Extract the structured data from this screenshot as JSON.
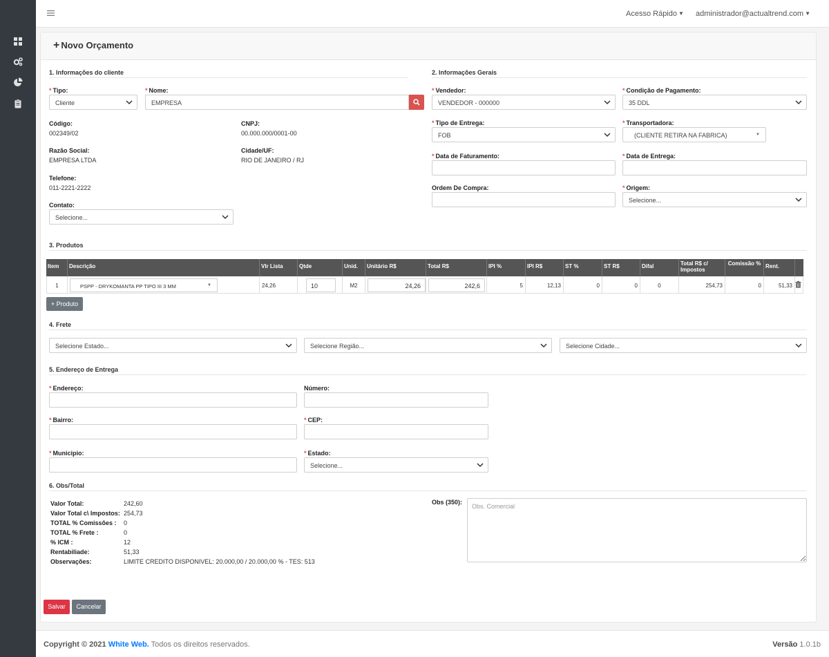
{
  "topbar": {
    "quick_access": "Acesso Rápido",
    "user": "administrador@actualtrend.com"
  },
  "page": {
    "title": "Novo Orçamento"
  },
  "client": {
    "section": "1. Informações do cliente",
    "tipo_label": "Tipo:",
    "tipo_value": "Cliente",
    "nome_label": "Nome:",
    "nome_value": "EMPRESA",
    "codigo_label": "Código:",
    "codigo_value": "002349/02",
    "cnpj_label": "CNPJ:",
    "cnpj_value": "00.000.000/0001-00",
    "razao_label": "Razão Social:",
    "razao_value": "EMPRESA LTDA",
    "cidade_label": "Cidade/UF:",
    "cidade_value": "RIO DE JANEIRO / RJ",
    "telefone_label": "Telefone:",
    "telefone_value": "011-2221-2222",
    "contato_label": "Contato:",
    "contato_value": "Selecione..."
  },
  "general": {
    "section": "2. Informações Gerais",
    "vendedor_label": "Vendedor:",
    "vendedor_value": "VENDEDOR - 000000",
    "condicao_label": "Condição de Pagamento:",
    "condicao_value": "35 DDL",
    "entrega_label": "Tipo de Entrega:",
    "entrega_value": "FOB",
    "transportadora_label": "Transportadora:",
    "transportadora_value": "(CLIENTE RETIRA NA FABRICA)",
    "faturamento_label": "Data de Faturamento:",
    "data_entrega_label": "Data de Entrega:",
    "ordem_label": "Ordem De Compra:",
    "origem_label": "Origem:",
    "origem_value": "Selecione..."
  },
  "products": {
    "section": "3. Produtos",
    "headers": [
      "Item",
      "Descrição",
      "Vlr Lista",
      "Qtde",
      "Unid.",
      "Unitário R$",
      "Total R$",
      "IPI %",
      "IPI R$",
      "ST %",
      "ST R$",
      "Difal",
      "Total R$ c/ Impostos",
      "Comissão %",
      "Rent."
    ],
    "row": {
      "item": "1",
      "descricao": "PSPP - DRYKOMANTA PP TIPO III 3 MM",
      "vlr_lista": "24,26",
      "qtde": "10",
      "unid": "M2",
      "unitario": "24,26",
      "total": "242,6",
      "ipi_pct": "5",
      "ipi_val": "12,13",
      "st_pct": "0",
      "st_val": "0",
      "difal": "0",
      "total_imp": "254,73",
      "comissao": "0",
      "rent": "51,33"
    },
    "add_button": "+ Produto"
  },
  "freight": {
    "section": "4. Frete",
    "estado": "Selecione Estado...",
    "regiao": "Selecione Região...",
    "cidade": "Selecione Cidade..."
  },
  "address": {
    "section": "5. Endereço de Entrega",
    "endereco_label": "Endereço:",
    "numero_label": "Número:",
    "bairro_label": "Bairro:",
    "cep_label": "CEP:",
    "municipio_label": "Municipio:",
    "estado_label": "Estado:",
    "estado_value": "Selecione..."
  },
  "totals": {
    "section": "6. Obs/Total",
    "rows": [
      {
        "label": "Valor Total:",
        "value": "242,60"
      },
      {
        "label": "Valor Total c\\ Impostos:",
        "value": "254,73"
      },
      {
        "label": "TOTAL % Comissões :",
        "value": "0"
      },
      {
        "label": "TOTAL % Frete :",
        "value": "0"
      },
      {
        "label": "% ICM :",
        "value": "12"
      },
      {
        "label": "Rentabiliade:",
        "value": "51,33"
      },
      {
        "label": "Observações:",
        "value": "LIMITE CREDITO DISPONIVEL: 20.000,00 / 20.000,00 % - TES: 513"
      }
    ],
    "obs_label": "Obs (350):",
    "obs_placeholder": "Obs. Comercial"
  },
  "actions": {
    "save": "Salvar",
    "cancel": "Cancelar"
  },
  "footer": {
    "copyright": "Copyright © 2021",
    "brand": "White Web.",
    "rights": "Todos os direitos reservados.",
    "version_label": "Versão",
    "version": "1.0.1b"
  },
  "colors": {
    "sidebar": "#343a40",
    "danger": "#dc3545",
    "table_header": "#555555",
    "secondary": "#6c757d"
  }
}
